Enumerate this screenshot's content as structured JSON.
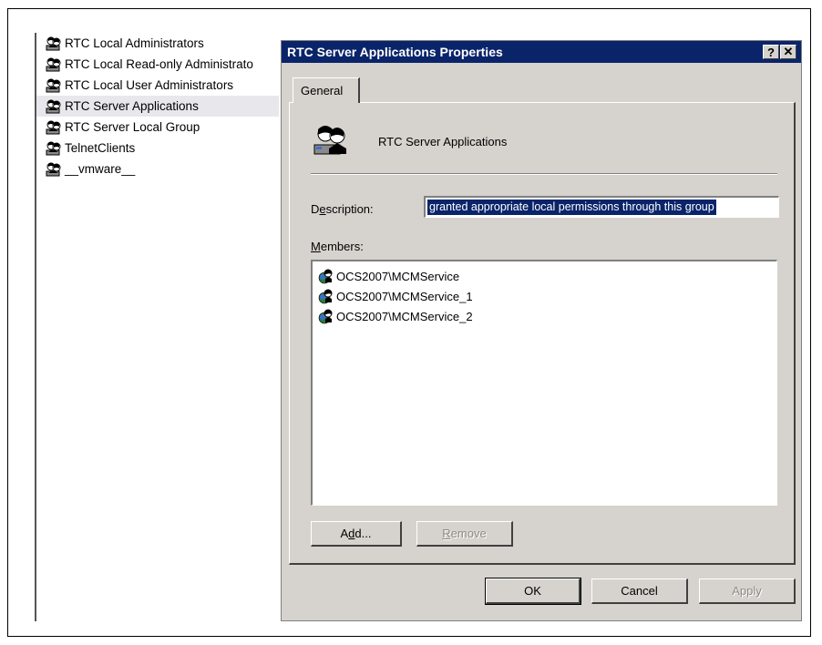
{
  "groups_list": {
    "items": [
      {
        "label": "RTC Local Administrators",
        "selected": false
      },
      {
        "label": "RTC Local Read-only Administrato",
        "selected": false
      },
      {
        "label": "RTC Local User Administrators",
        "selected": false
      },
      {
        "label": "RTC Server Applications",
        "selected": true
      },
      {
        "label": "RTC Server Local Group",
        "selected": false
      },
      {
        "label": "TelnetClients",
        "selected": false
      },
      {
        "label": "__vmware__",
        "selected": false
      }
    ]
  },
  "dialog": {
    "title": "RTC Server Applications Properties",
    "help_button": "?",
    "close_button": "✕",
    "tab_label": "General",
    "group_name": "RTC Server Applications",
    "description": {
      "label_prefix": "D",
      "label_underlined": "e",
      "label_rest": "scription:",
      "value": "granted appropriate local permissions through this group"
    },
    "members": {
      "label_underlined": "M",
      "label_rest": "embers:",
      "items": [
        "OCS2007\\MCMService",
        "OCS2007\\MCMService_1",
        "OCS2007\\MCMService_2"
      ]
    },
    "add_button": {
      "prefix": "A",
      "underlined": "d",
      "rest": "d..."
    },
    "remove_button": {
      "underlined": "R",
      "rest": "emove"
    },
    "ok_button": "OK",
    "cancel_button": "Cancel",
    "apply_button": "Apply"
  },
  "colors": {
    "titlebar": "#0a246a",
    "dialog_face": "#d6d3ce",
    "selection": "#0a246a"
  },
  "icons": {
    "group": "users-group-icon",
    "member": "user-icon",
    "close": "close-icon",
    "help": "help-icon"
  }
}
